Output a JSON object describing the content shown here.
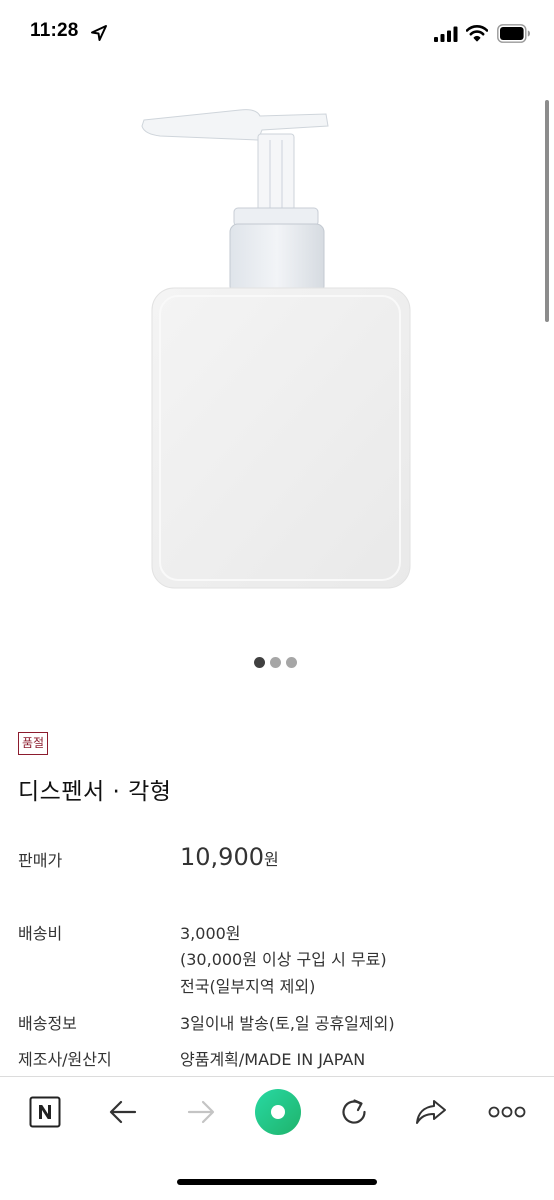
{
  "status_bar": {
    "time": "11:28"
  },
  "product": {
    "badge": "품절",
    "title": "디스펜서 · 각형",
    "price_label": "판매가",
    "price_amount": "10,900",
    "price_unit": "원",
    "shipping_label": "배송비",
    "shipping_lines": [
      "3,000원",
      "(30,000원 이상 구입 시 무료)",
      "전국(일부지역 제외)"
    ],
    "delivery_label": "배송정보",
    "delivery_value": "3일이내 발송(토,일 공휴일제외)",
    "maker_label": "제조사/원산지",
    "maker_value": "양품계획/MADE IN JAPAN"
  },
  "carousel": {
    "total": 3,
    "active": 1
  },
  "colors": {
    "badge": "#8c1c2e",
    "green_button": "#2ecc71",
    "text": "#333333"
  }
}
